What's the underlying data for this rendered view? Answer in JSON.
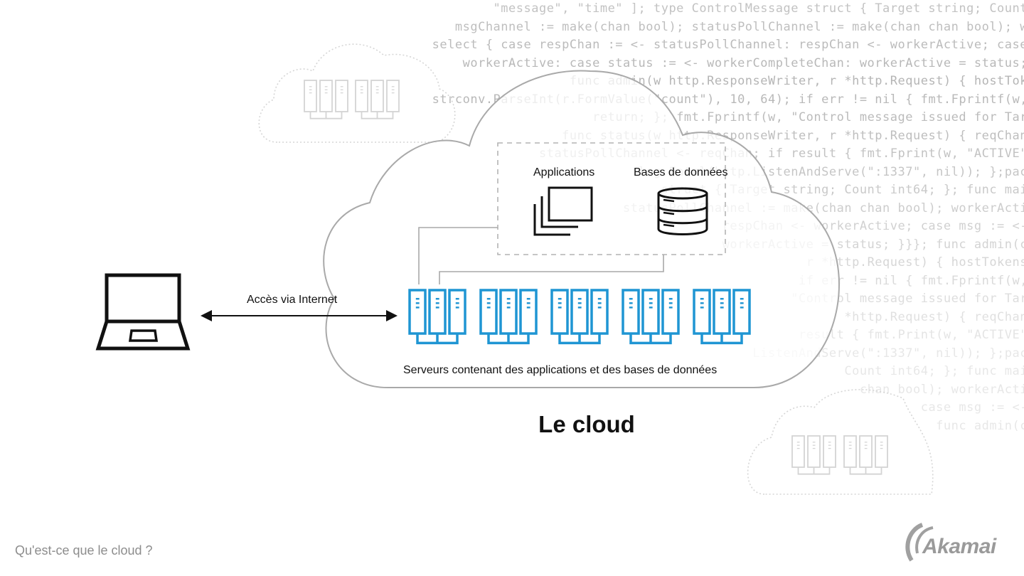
{
  "diagram": {
    "title": "Le cloud",
    "footer_caption": "Qu'est-ce que le cloud ?",
    "brand": {
      "name": "Akamai",
      "logo_icon": "akamai-logo-icon"
    },
    "client": {
      "icon": "laptop-icon"
    },
    "connection": {
      "label": "Accès via Internet",
      "type": "bidirectional-arrow"
    },
    "cloud": {
      "services_box": {
        "items": [
          {
            "label": "Applications",
            "icon": "stacked-windows-icon"
          },
          {
            "label": "Bases de données",
            "icon": "database-icon"
          }
        ]
      },
      "servers": {
        "rack_groups": 5,
        "servers_per_group": 3,
        "caption": "Serveurs contenant des applications et des bases de données",
        "color": "#1f95d3"
      }
    },
    "background_clouds": [
      {
        "position": "top-left",
        "rack_groups": 2
      },
      {
        "position": "bottom-right",
        "rack_groups": 2
      }
    ],
    "background_code": [
      "\"message\", \"time\" ]; type ControlMessage struct { Target string; Count",
      "msgChannel := make(chan bool); statusPollChannel := make(chan chan bool); w",
      "select { case respChan := <- statusPollChannel: respChan <- workerActive; case",
      "workerActive: case status := <- workerCompleteChan: workerActive = status;",
      "func admin(w http.ResponseWriter, r *http.Request) { hostTok",
      "strconv.ParseInt(r.FormValue(\"count\"), 10, 64); if err != nil { fmt.Fprintf(w,",
      "return; }; fmt.Fprintf(w, \"Control message issued for Tar",
      "func status(w http.ResponseWriter, r *http.Request) { reqChan",
      "statusPollChannel <- reqChan; if result { fmt.Fprint(w, \"ACTIVE\"",
      "log.Fatal(http.ListenAndServe(\":1337\", nil)); };pac",
      "struct { Target string; Count int64; }; func mai",
      "statusPollChannel := make(chan chan bool); workerActi",
      "respChan <- workerActive; case msg := <-",
      "workerActive = status; }}}; func admin(c",
      "r *http.Request) { hostTokens",
      "if err != nil { fmt.Fprintf(w,",
      "\"Control message issued for Tar",
      "*http.Request) { reqChan",
      "result { fmt.Print(w, \"ACTIVE\"",
      "ListenAndServe(\":1337\", nil)); };pac",
      "Count int64; }; func mai",
      "chan bool); workerActi",
      "case msg := <-",
      "func admin(c"
    ]
  }
}
